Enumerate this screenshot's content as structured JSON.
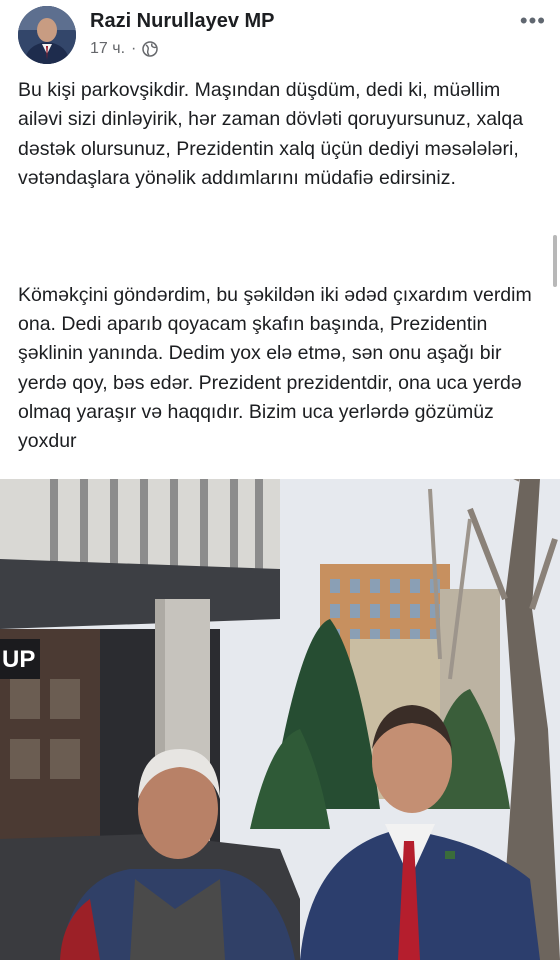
{
  "post": {
    "author": "Razi Nurullayev MP",
    "time": "17 ч.",
    "separator": "·",
    "icons": {
      "audience": "globe-icon",
      "menu": "more-options-icon"
    },
    "paragraph1": "Bu kişi parkovşikdir. Maşından düşdüm, dedi ki, müəllim ailəvi sizi dinləyirik, hər zaman dövləti qoruyursunuz, xalqa dəstək olursunuz, Prezidentin xalq üçün dediyi məsələləri, vətəndaşlara yönəlik addımlarını müdafiə edirsiniz.",
    "paragraph2": "Köməkçini göndərdim, bu şəkildən iki ədəd çıxardım verdim ona. Dedi aparıb qoyacam şkafın başında, Prezidentin şəklinin yanında. Dedim yox elə etmə, sən onu aşağı bir yerdə qoy, bəs edər. Prezident prezidentdir, ona uca yerdə olmaq yaraşır və haqqıdır. Bizim uca yerlərdə gözümüz yoxdur"
  },
  "photo": {
    "storefront_sign": "UP"
  },
  "colors": {
    "sky": "#e6e9ee",
    "suit": "#2c3e6d",
    "tie": "#b51e2d"
  }
}
